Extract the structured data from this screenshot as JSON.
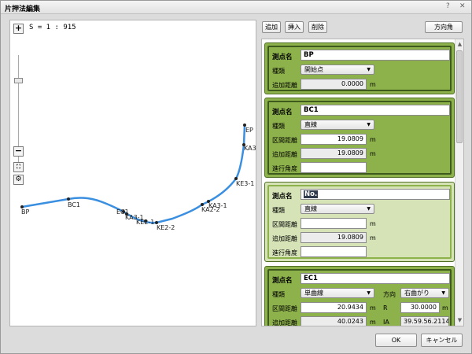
{
  "window": {
    "title": "片押法編集",
    "help_icon": "?",
    "close_icon": "✕"
  },
  "map": {
    "scale_label": "S = 1 : 915",
    "zoom_in": "+",
    "zoom_out": "−",
    "points": [
      {
        "label": "BP"
      },
      {
        "label": "BC1"
      },
      {
        "label": "EC1"
      },
      {
        "label": "KA3-1"
      },
      {
        "label": "KE2-1"
      },
      {
        "label": "KE2-2"
      },
      {
        "label": "KA2-2"
      },
      {
        "label": "KA3-1"
      },
      {
        "label": "KE3-1"
      },
      {
        "label": "KA3"
      },
      {
        "label": "EP"
      }
    ]
  },
  "toolbar": {
    "add": "追加",
    "insert": "挿入",
    "delete": "削除",
    "azimuth": "方向角"
  },
  "labels": {
    "point_name": "測点名",
    "type": "種類",
    "section_dist": "区間距離",
    "added_dist": "追加距離",
    "advance_angle": "進行角度",
    "direction": "方向",
    "r": "R",
    "ia": "IA",
    "unit_m": "m"
  },
  "cards": [
    {
      "name": "BP",
      "type": "開始点",
      "added_dist": "0.0000"
    },
    {
      "name": "BC1",
      "type": "直線",
      "section_dist": "19.0809",
      "added_dist": "19.0809",
      "advance_angle": ""
    },
    {
      "name": "No.",
      "type": "直線",
      "section_dist": "",
      "added_dist": "19.0809",
      "advance_angle": ""
    },
    {
      "name": "EC1",
      "type": "単曲線",
      "section_dist": "20.9434",
      "added_dist": "40.0243",
      "direction": "右曲がり",
      "r": "30.0000",
      "ia": "39.59.56.2114"
    }
  ],
  "footer": {
    "ok": "OK",
    "cancel": "キャンセル"
  },
  "colors": {
    "card": "#8db24b",
    "card_selected": "#d5e3b7",
    "path": "#3a8fe0"
  }
}
